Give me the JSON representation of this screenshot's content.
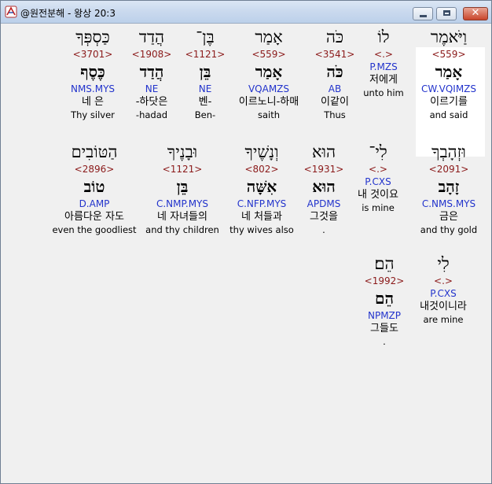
{
  "window": {
    "title": "@원전분해 - 왕상 20:3"
  },
  "rows": [
    [
      {
        "heb": "וַיֹּאמֶר",
        "strong": "<559>",
        "lex": "אָמַר",
        "parse": "CW.VQIMZS",
        "kor": "이르기를",
        "eng": "and said"
      },
      {
        "heb": "לוֹ",
        "strong": "<.>",
        "lex": "",
        "parse": "P.MZS",
        "kor": "저에게",
        "eng": "unto him"
      },
      {
        "heb": "כֹּה",
        "strong": "<3541>",
        "lex": "כֹּה",
        "parse": "AB",
        "kor": "이같이",
        "eng": "Thus"
      },
      {
        "heb": "אָמַר",
        "strong": "<559>",
        "lex": "אָמַר",
        "parse": "VQAMZS",
        "kor": "이르노니-하매",
        "eng": "saith"
      },
      {
        "heb": "בֶּן־",
        "strong": "<1121>",
        "lex": "בֵּן",
        "parse": "NE",
        "kor": "벤-",
        "eng": "Ben-"
      },
      {
        "heb": "הֲדַד",
        "strong": "<1908>",
        "lex": "הֲדַד",
        "parse": "NE",
        "kor": "-하닷은",
        "eng": "-hadad"
      },
      {
        "heb": "כַּסְפְּךָ",
        "strong": "<3701>",
        "lex": "כֶּסֶף",
        "parse": "NMS.MYS",
        "kor": "네 은",
        "eng": "Thy silver"
      }
    ],
    [
      {
        "heb": "וּזְהָבְךָ",
        "strong": "<2091>",
        "lex": "זָהָב",
        "parse": "C.NMS.MYS",
        "kor": "금은",
        "eng": "and thy gold"
      },
      {
        "heb": "לִי־",
        "strong": "<.>",
        "lex": "",
        "parse": "P.CXS",
        "kor": "내 것이요",
        "eng": "is mine"
      },
      {
        "heb": "הוּא",
        "strong": "<1931>",
        "lex": "הוּא",
        "parse": "APDMS",
        "kor": "그것을",
        "eng": "."
      },
      {
        "heb": "וְנָשֶׁיךָ",
        "strong": "<802>",
        "lex": "אִשָּׁה",
        "parse": "C.NFP.MYS",
        "kor": "네 처들과",
        "eng": "thy wives also"
      },
      {
        "heb": "וּבָנֶיךָ",
        "strong": "<1121>",
        "lex": "בֵּן",
        "parse": "C.NMP.MYS",
        "kor": "네 자녀들의",
        "eng": "and thy children"
      },
      {
        "heb": "הַטּוֹבִים",
        "strong": "<2896>",
        "lex": "טוֹב",
        "parse": "D.AMP",
        "kor": "아름다운 자도",
        "eng": "even the goodliest"
      }
    ],
    [
      {
        "heb": "לִי",
        "strong": "<.>",
        "lex": "",
        "parse": "P.CXS",
        "kor": "내것이니라",
        "eng": "are mine"
      },
      {
        "heb": "הֵם׃",
        "strong": "<1992>",
        "lex": "הֵם",
        "parse": "NPMZP",
        "kor": "그들도",
        "eng": "."
      }
    ]
  ]
}
